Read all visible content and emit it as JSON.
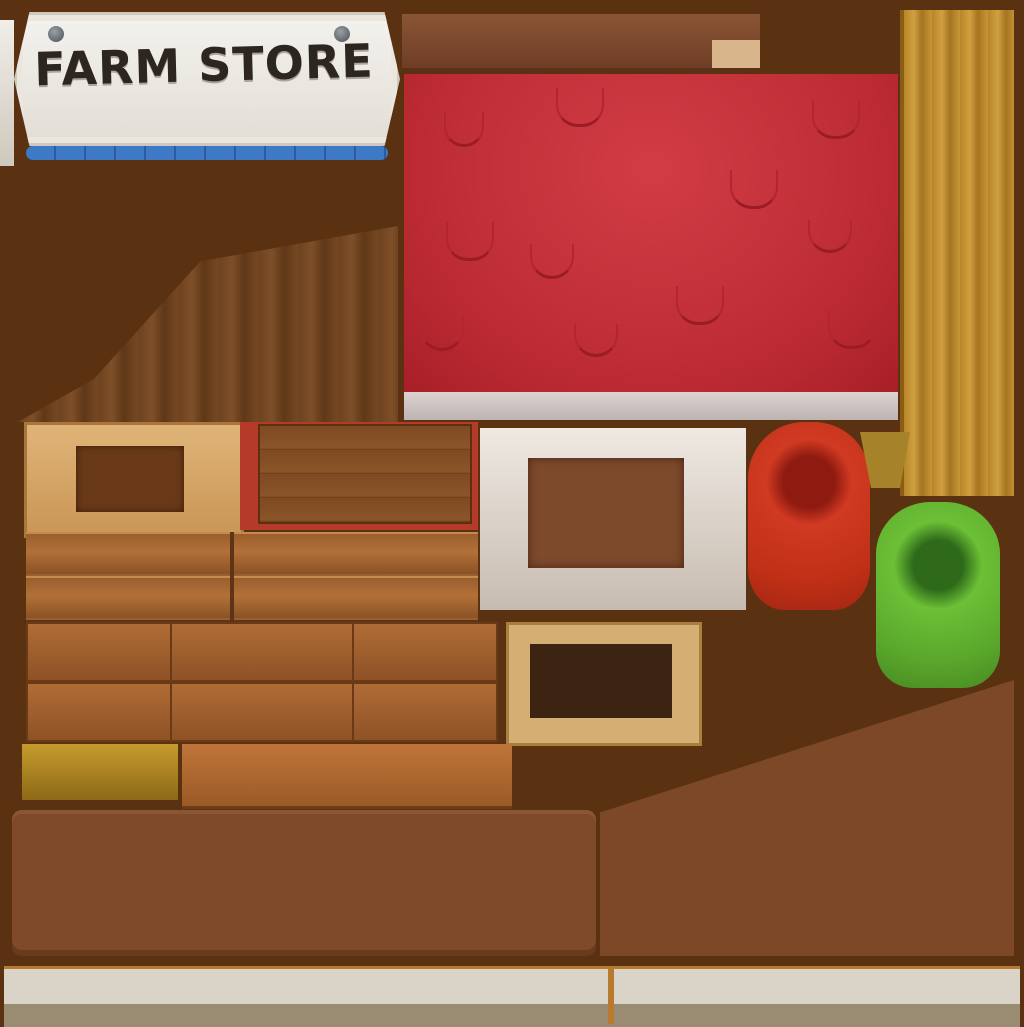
{
  "sign": {
    "title": "FARM STORE"
  },
  "progress": {
    "fraction": 1.0
  },
  "colors": {
    "background": "#5a3212",
    "awning_red": "#bb2a33",
    "progress_blue": "#3d79c4",
    "pepper_red": "#c03016",
    "pepper_green": "#5aa72c"
  }
}
